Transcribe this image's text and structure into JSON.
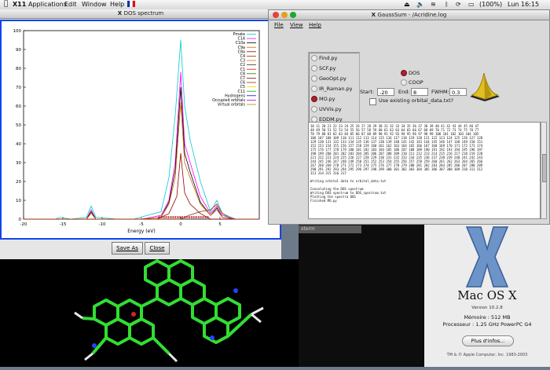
{
  "menubar": {
    "items": [
      "X11",
      "Applications",
      "Edit",
      "Window",
      "Help"
    ],
    "battery": "(100%)",
    "clock": "Lun 16:15"
  },
  "dos_window": {
    "title": "DOS spectrum",
    "save_label": "Save As",
    "close_label": "Close",
    "legend": [
      "Pmate",
      "C14",
      "C10a",
      "C9a",
      "C8a",
      "C4",
      "C3",
      "C2",
      "C1",
      "C8",
      "C7",
      "C6",
      "C5",
      "C11",
      "Hydrogens",
      "Occupied orbitals",
      "Virtual orbitals"
    ],
    "xlabel": "Energy (eV)"
  },
  "chart_data": {
    "type": "line",
    "title": "",
    "xlabel": "Energy (eV)",
    "ylabel": "",
    "xlim": [
      -20,
      10
    ],
    "ylim": [
      0,
      100
    ],
    "x_ticks": [
      -20,
      -15,
      -10,
      -5,
      0,
      5
    ],
    "y_ticks": [
      0,
      10,
      20,
      30,
      40,
      50,
      60,
      70,
      80,
      90,
      100
    ],
    "series": [
      {
        "name": "Pmate",
        "color": "#00cccc",
        "x": [
          -20,
          -16,
          -15.3,
          -14,
          -12,
          -11.4,
          -10.8,
          -8,
          -6,
          -2.5,
          -1.5,
          -0.7,
          0,
          0.5,
          1.2,
          2.5,
          3.8,
          4.6,
          5.3,
          7,
          10
        ],
        "values": [
          0,
          0,
          1,
          0,
          1,
          7,
          1,
          0,
          0,
          4,
          22,
          55,
          95,
          60,
          42,
          20,
          4,
          10,
          3,
          0,
          0
        ]
      },
      {
        "name": "C14",
        "color": "#ff00ff",
        "x": [
          -20,
          -12,
          -11.4,
          -10.8,
          -5,
          -2.5,
          -1.5,
          -0.7,
          0,
          0.5,
          1.2,
          2.5,
          3.8,
          4.6,
          5.3,
          7,
          10
        ],
        "values": [
          0,
          0,
          5,
          0,
          0,
          2,
          10,
          30,
          78,
          40,
          30,
          12,
          3,
          7,
          2,
          0,
          0
        ]
      },
      {
        "name": "C10a",
        "color": "#000000",
        "x": [
          -20,
          -12,
          -11.4,
          -10.8,
          -5,
          -2.5,
          -1.5,
          -0.7,
          0,
          0.5,
          1.2,
          2.5,
          3.8,
          4.6,
          5.3,
          7,
          10
        ],
        "values": [
          0,
          0,
          4,
          0,
          0,
          1,
          9,
          26,
          70,
          35,
          25,
          9,
          2,
          6,
          1,
          0,
          0
        ]
      },
      {
        "name": "C9a",
        "color": "#cc6600",
        "x": [
          -20,
          -12,
          -11.4,
          -10.8,
          -5,
          -2.5,
          -1.5,
          -0.7,
          0,
          0.5,
          1.2,
          2.5,
          3.8,
          4.6,
          5.3,
          7,
          10
        ],
        "values": [
          0,
          0,
          3,
          0,
          0,
          1,
          8,
          22,
          62,
          30,
          22,
          8,
          2,
          5,
          1,
          0,
          0
        ]
      },
      {
        "name": "Occupied orbitals",
        "color": "#990000",
        "x": [
          -20,
          -12,
          -11.4,
          -10.8,
          -5,
          -3,
          -1.5,
          -0.5,
          0,
          0.5,
          1.2,
          2.5,
          3.8,
          10
        ],
        "values": [
          0,
          0,
          0,
          0,
          0,
          0,
          3,
          12,
          35,
          14,
          8,
          3,
          0,
          0
        ]
      },
      {
        "name": "Virtual orbitals",
        "color": "#993300",
        "x": [
          -20,
          -2,
          0,
          1,
          2.5,
          3.8,
          4.6,
          5.3,
          6.5,
          10
        ],
        "values": [
          0,
          0,
          0,
          2,
          4,
          5,
          8,
          3,
          0,
          0
        ]
      }
    ]
  },
  "gausssum": {
    "title": "GaussSum - /Acridine.log",
    "menu": [
      "File",
      "View",
      "Help"
    ],
    "scripts": [
      "Find.py",
      "SCF.py",
      "GeoOpt.py",
      "IR_Raman.py",
      "MO.py",
      "UVVis.py",
      "EDDM.py"
    ],
    "selected_script": "MO.py",
    "mode_options": [
      "DOS",
      "COOP"
    ],
    "selected_mode": "DOS",
    "start_label": "Start:",
    "start_value": "-20",
    "end_label": "End:",
    "end_value": "8",
    "fwhm_label": "FWHM:",
    "fwhm_value": "0.3",
    "checkbox_label": "Use existing orbital_data.txt?",
    "output_lines": [
      "10 11 20 21 22 23 24 25 26 27 28 29 30 31 32 33 34 35 36 37 38 39 40 41 42 43 44 45 46 47",
      "48 49 50 51 52 53 54 55 56 57 58 59 60 61 62 63 64 65 66 67 68 69 70 71 72 73 74 75 76 77",
      "78 79 80 81 82 83 84 85 86 87 88 89 90 91 92 93 94 95 96 97 98 99 100 101 102 103 104 105",
      "106 107 108 109 110 111 112 113 114 115 116 117 118 119 120 121 122 123 124 125 126 127 128",
      "129 130 131 132 133 134 135 136 137 138 139 140 141 142 143 144 145 146 147 148 149 150 151",
      "152 153 154 155 156 157 158 159 160 161 162 163 164 165 166 167 168 169 170 171 172 173 174",
      "175 176 177 178 179 180 181 182 183 184 185 186 187 188 189 190 191 192 193 194 195 196 197",
      "198 199 200 201 202 203 204 205 206 207 208 209 210 211 212 213 214 215 216 217 218 219 220",
      "221 222 223 224 225 226 227 228 229 230 231 232 233 234 235 236 237 238 239 240 241 242 243",
      "244 245 246 247 248 249 250 251 252 253 254 255 256 257 258 259 260 261 262 263 264 265 266",
      "267 268 269 270 271 272 273 274 275 276 277 278 279 280 281 282 283 284 285 286 287 288 289",
      "290 291 292 293 294 295 296 297 298 299 300 301 302 303 304 305 306 307 308 309 310 311 312",
      "313 314 315 316 317",
      "",
      "Writing orbital data to orbital_data.txt",
      "",
      "Convoluting the DOS spectrum",
      "Writing DOS spectrum to DOS_spectrum.txt",
      "Plotting the spectra DOS",
      "Finished MO.py"
    ]
  },
  "terminal": {
    "title": "xterm"
  },
  "about": {
    "os_name": "Mac OS X",
    "version": "Version 10.2.8",
    "memory": "Mémoire : 512 MB",
    "processor": "Processeur : 1.25 GHz PowerPC G4",
    "more_info": "Plus d'infos...",
    "copyright": "TM & © Apple Computer, Inc. 1983-2003"
  },
  "colors": {
    "window_border_blue": "#1144ee",
    "selected_radio": "#b31c2d"
  }
}
